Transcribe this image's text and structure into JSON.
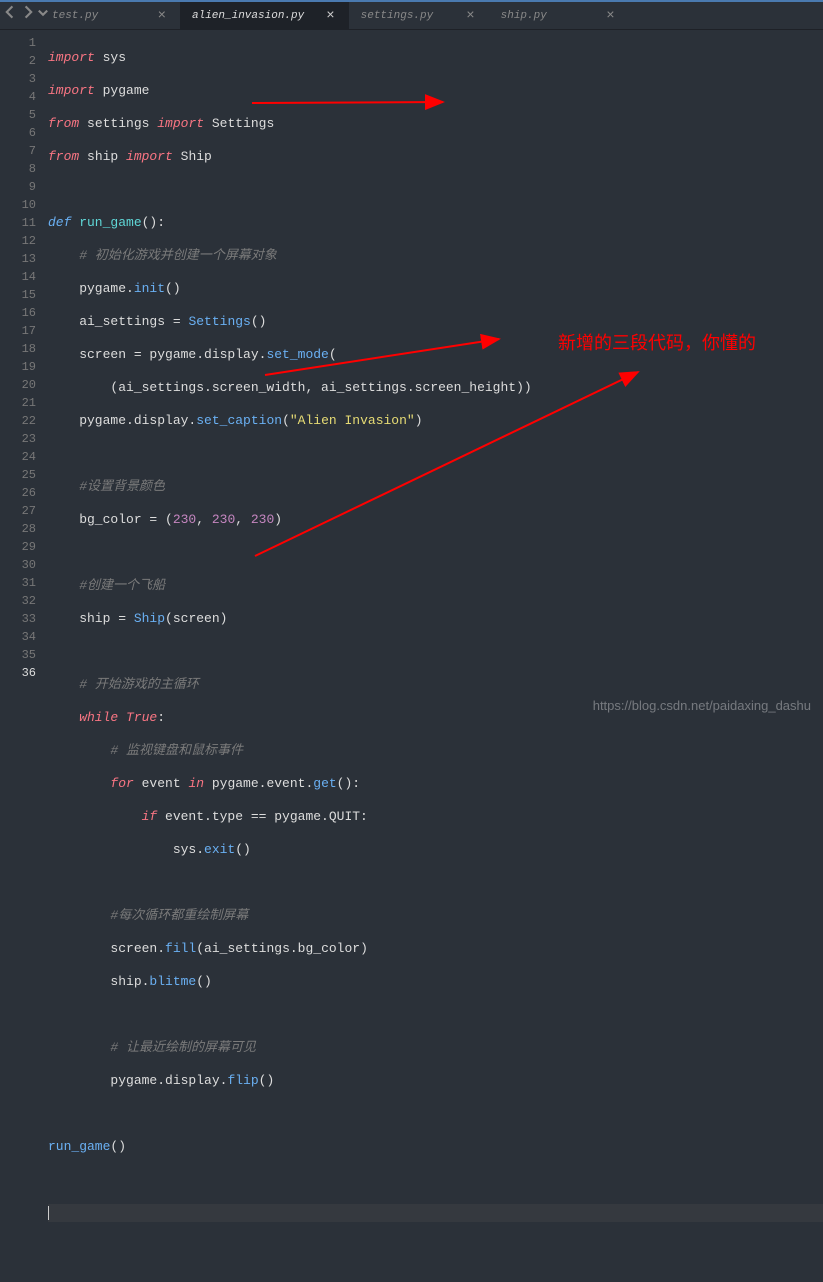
{
  "tabs": [
    {
      "label": "test.py",
      "active": false
    },
    {
      "label": "alien_invasion.py",
      "active": true
    },
    {
      "label": "settings.py",
      "active": false
    },
    {
      "label": "ship.py",
      "active": false
    }
  ],
  "annotation": "新增的三段代码，你懂的",
  "watermark": "https://blog.csdn.net/paidaxing_dashu",
  "code": {
    "l1_import": "import",
    "l1_sys": " sys",
    "l2_import": "import",
    "l2_pygame": " pygame",
    "l3_from": "from",
    "l3_settings": " settings ",
    "l3_import": "import",
    "l3_Settings": " Settings",
    "l4_from": "from",
    "l4_ship": " ship ",
    "l4_import": "import",
    "l4_Ship": " Ship",
    "l6_def": "def",
    "l6_name": " run_game",
    "l6_paren": "():",
    "l7_comment": "    # 初始化游戏并创建一个屏幕对象",
    "l8_a": "    pygame.",
    "l8_fn": "init",
    "l8_b": "()",
    "l9_a": "    ai_settings = ",
    "l9_fn": "Settings",
    "l9_b": "()",
    "l10_a": "    screen = pygame.display.",
    "l10_fn": "set_mode",
    "l10_b": "(",
    "l11": "        (ai_settings.screen_width, ai_settings.screen_height))",
    "l12_a": "    pygame.display.",
    "l12_fn": "set_caption",
    "l12_b": "(",
    "l12_str": "\"Alien Invasion\"",
    "l12_c": ")",
    "l14_comment": "    #设置背景颜色",
    "l15_a": "    bg_color = (",
    "l15_n1": "230",
    "l15_c1": ", ",
    "l15_n2": "230",
    "l15_c2": ", ",
    "l15_n3": "230",
    "l15_b": ")",
    "l17_comment": "    #创建一个飞船",
    "l18_a": "    ship = ",
    "l18_fn": "Ship",
    "l18_b": "(screen)",
    "l20_comment": "    # 开始游戏的主循环",
    "l21_while": "    while",
    "l21_true": " True",
    "l21_colon": ":",
    "l22_comment": "        # 监视键盘和鼠标事件",
    "l23_for": "        for",
    "l23_a": " event ",
    "l23_in": "in",
    "l23_b": " pygame.event.",
    "l23_fn": "get",
    "l23_c": "():",
    "l24_if": "            if",
    "l24_a": " event.type == pygame.QUIT:",
    "l25_a": "                sys.",
    "l25_fn": "exit",
    "l25_b": "()",
    "l27_comment": "        #每次循环都重绘制屏幕",
    "l28_a": "        screen.",
    "l28_fn": "fill",
    "l28_b": "(ai_settings.bg_color)",
    "l29_a": "        ship.",
    "l29_fn": "blitme",
    "l29_b": "()",
    "l31_comment": "        # 让最近绘制的屏幕可见",
    "l32_a": "        pygame.display.",
    "l32_fn": "flip",
    "l32_b": "()",
    "l34_a": "run_game",
    "l34_b": "()"
  },
  "line_count": 36,
  "current_line": 36
}
